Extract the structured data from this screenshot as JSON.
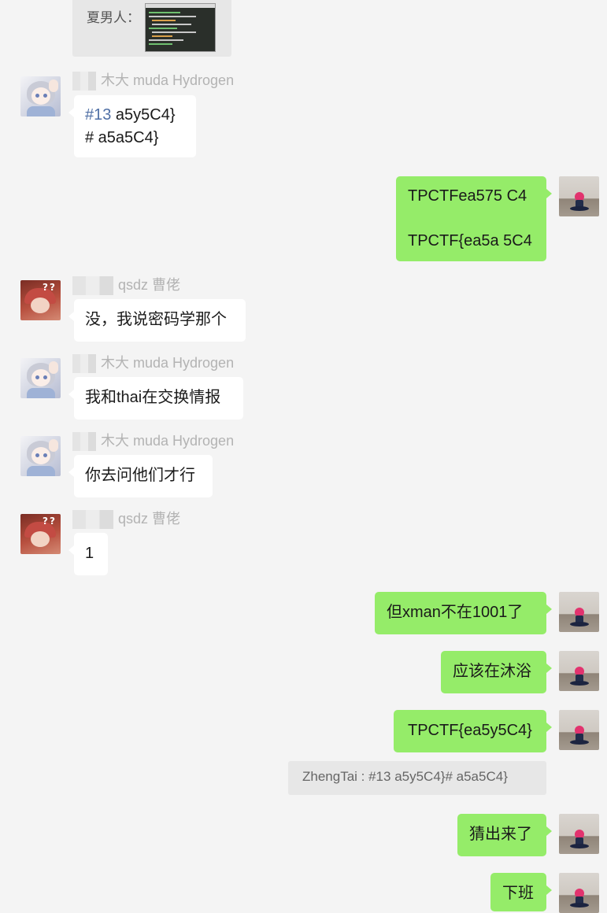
{
  "quoted_top": {
    "label": "夏男人："
  },
  "messages": [
    {
      "sender": "木大 muda Hydrogen",
      "line1_tag": "#13",
      "line1_rest": " a5y5C4}",
      "line2": "#  a5a5C4}"
    },
    {
      "line1": "TPCTFea575 C4",
      "line2": "TPCTF{ea5a 5C4"
    },
    {
      "sender": "qsdz 曹佬",
      "text": "没，我说密码学那个"
    },
    {
      "sender": "木大 muda Hydrogen",
      "text": "我和thai在交换情报"
    },
    {
      "sender": "木大 muda Hydrogen",
      "text": "你去问他们才行"
    },
    {
      "sender": "qsdz 曹佬",
      "text": "1"
    },
    {
      "text": "但xman不在1001了"
    },
    {
      "text": "应该在沐浴"
    },
    {
      "text": "TPCTF{ea5y5C4}"
    },
    {
      "quote": "ZhengTai : #13 a5y5C4}#  a5a5C4}"
    },
    {
      "text": "猜出来了"
    },
    {
      "text": "下班"
    }
  ],
  "icons": {
    "girl_avatar": "avatar-anime-girl-icon",
    "red_avatar": "avatar-red-hat-icon",
    "self_avatar": "avatar-flower-icon"
  },
  "colors": {
    "background": "#f4f4f4",
    "bubble_self": "#95ec69",
    "bubble_other": "#ffffff",
    "sender_name": "#b3b3b3",
    "quote_bg": "#e7e7e7"
  }
}
